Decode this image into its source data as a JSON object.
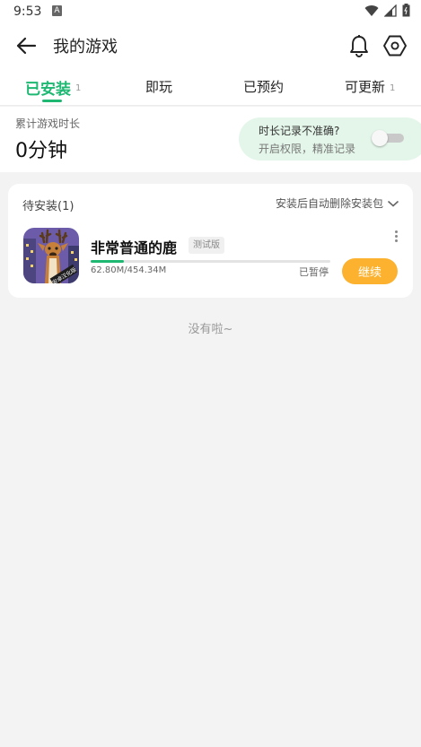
{
  "status_bar": {
    "time": "9:53",
    "notification_glyph": "A",
    "icons": [
      "wifi-icon",
      "signal-icon",
      "battery-icon"
    ]
  },
  "header": {
    "title": "我的游戏",
    "icons": [
      "back-arrow-icon",
      "bell-icon",
      "settings-hex-icon"
    ]
  },
  "tabs": [
    {
      "label": "已安装",
      "count": "1",
      "active": true
    },
    {
      "label": "即玩",
      "count": "",
      "active": false
    },
    {
      "label": "已预约",
      "count": "",
      "active": false
    },
    {
      "label": "可更新",
      "count": "1",
      "active": false
    }
  ],
  "summary": {
    "label": "累计游戏时长",
    "value": "0分钟",
    "hint_title": "时长记录不准确?",
    "hint_subtitle": "开启权限，精准记录",
    "toggle_on": false
  },
  "pending": {
    "title": "待安装(1)",
    "auto_delete_label": "安装后自动删除安装包",
    "game": {
      "name": "非常普通的鹿",
      "badge": "测试版",
      "size_text": "62.80M/454.34M",
      "progress_fraction": 0.138,
      "status": "已暂停",
      "action_label": "继续",
      "icon_text": "安卓汉化版"
    }
  },
  "footer": {
    "end_text": "没有啦~"
  },
  "colors": {
    "accent": "#1fb873",
    "button": "#fcb22e",
    "hint_bg": "#e4f6ea",
    "page_bg": "#f3f3f3"
  }
}
